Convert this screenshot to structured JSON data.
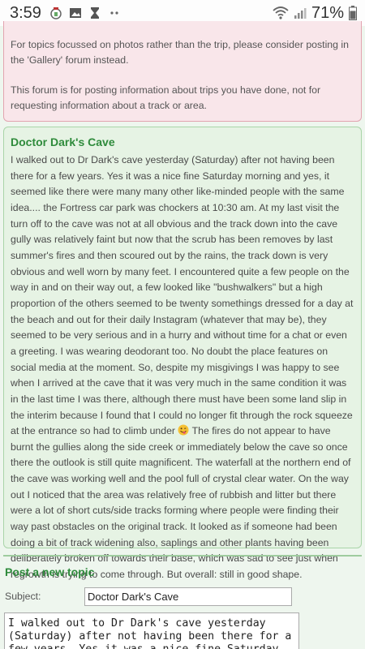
{
  "status_bar": {
    "time": "3:59",
    "battery_percent": "71%",
    "icons": [
      "app-badge-icon",
      "image-icon",
      "hourglass-icon",
      "dots-icon",
      "wifi-icon",
      "signal-icon",
      "battery-icon"
    ]
  },
  "notice": {
    "paragraph1": "For topics focussed on photos rather than the trip, please consider posting in the 'Gallery' forum instead.",
    "paragraph2": "This forum is for posting information about trips you have done, not for requesting information about a track or area."
  },
  "post": {
    "title": "Doctor Dark's Cave",
    "body_part1": "I walked out to Dr Dark's cave yesterday (Saturday) after not having been there for a few years. Yes it was a nice fine Saturday morning and yes, it seemed like there were many many other like-minded people with the same idea.... the Fortress car park was chockers at 10:30 am. At my last visit the turn off to the cave was not at all obvious and the track down into the cave gully was relatively faint but now that the scrub has been removes by last summer's fires and then scoured out by the rains, the track down is very obvious and well worn by many feet. I encountered quite a few people on the way in and on their way out, a few looked like \"bushwalkers\" but a high proportion of the others seemed to be twenty somethings dressed for a day at the beach and out for their daily Instagram (whatever that may be), they seemed to be very serious and in a hurry and without time for a chat or even a greeting. I was wearing deodorant too. No doubt the place features on social media at the moment. So, despite my misgivings I was happy to see when I arrived at the cave that it was very much in the same condition it was in the last time I was there, although there must have been some land slip in the interim because I found that I could no longer fit through the rock squeeze at the entrance so had to climb under",
    "body_part2": "The fires do not appear to have burnt the gullies along the side creek or immediately below the cave so once there the outlook is still quite magnificent. The waterfall at the northern end of the cave was working well and the pool full of crystal clear water. On the way out I noticed that the area was relatively free of rubbish and litter but there were a lot of short cuts/side tracks forming where people were finding their way past obstacles on the original track. It looked as if someone had been doing a bit of track widening also, saplings and other plants having been deliberately broken off towards their base, which was sad to see just when regrowth is trying to come through. But overall: still in good shape.",
    "emoji_icon": "winking-tongue-emoji-icon"
  },
  "new_topic": {
    "heading": "Post a new topic",
    "subject_label": "Subject:",
    "subject_value": "Doctor Dark's Cave",
    "body_value": "I walked out to Dr Dark's cave yesterday (Saturday) after not having been there for a few years. Yes it was a nice fine Saturday"
  },
  "colors": {
    "accent_green": "#2f8b3c",
    "notice_bg": "#f9e6ea",
    "post_bg": "#e6f3e4"
  }
}
